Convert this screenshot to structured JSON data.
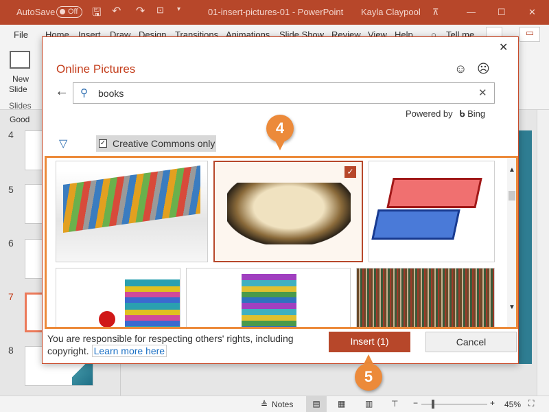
{
  "titlebar": {
    "autosave": "AutoSave",
    "autosave_state": "Off",
    "doc_title": "01-insert-pictures-01  -  PowerPoint",
    "user": "Kayla Claypool"
  },
  "tabs": [
    "File",
    "Home",
    "Insert",
    "Draw",
    "Design",
    "Transitions",
    "Animations",
    "Slide Show",
    "Review",
    "View",
    "Help",
    "Tell me"
  ],
  "ribbon": {
    "new_slide": "New",
    "new_slide2": "Slide",
    "group": "Slides"
  },
  "slides_pane": {
    "section": "Good",
    "numbers": [
      "4",
      "5",
      "6",
      "7",
      "8"
    ],
    "selected": "7"
  },
  "dialog": {
    "title": "Online Pictures",
    "search_value": "books",
    "powered_by": "Powered by",
    "bing": "Bing",
    "filter_label": "Creative Commons only",
    "filter_checked": true,
    "results": [
      {
        "name": "colorful-books-row",
        "selected": false
      },
      {
        "name": "old-open-books",
        "selected": true
      },
      {
        "name": "red-blue-books-clipart",
        "selected": false
      },
      {
        "name": "book-stack-apple",
        "selected": false
      },
      {
        "name": "book-stack-colorful",
        "selected": false
      },
      {
        "name": "bookshelf-library",
        "selected": false
      }
    ],
    "disclaimer": "You are responsible for respecting others' rights, including copyright.",
    "learn_more": "Learn more here",
    "insert": "Insert (1)",
    "cancel": "Cancel"
  },
  "callouts": [
    "4",
    "5"
  ],
  "status": {
    "notes": "Notes",
    "zoom": "45%"
  },
  "colors": {
    "accent": "#b7472a",
    "callout": "#ec8a3a"
  }
}
